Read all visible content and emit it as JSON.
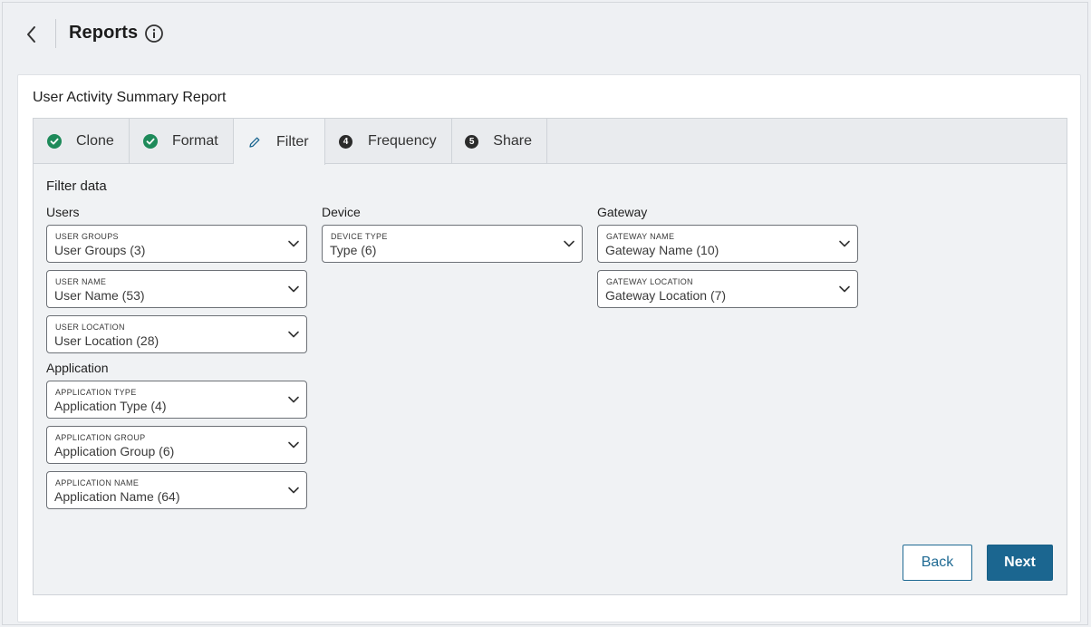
{
  "header": {
    "title": "Reports"
  },
  "report": {
    "title": "User Activity Summary Report"
  },
  "tabs": [
    {
      "label": "Clone",
      "status": "complete"
    },
    {
      "label": "Format",
      "status": "complete"
    },
    {
      "label": "Filter",
      "status": "active"
    },
    {
      "label": "Frequency",
      "status": "pending",
      "number": "4"
    },
    {
      "label": "Share",
      "status": "pending",
      "number": "5"
    }
  ],
  "filter": {
    "title": "Filter data",
    "users": {
      "label": "Users",
      "fields": [
        {
          "label": "USER GROUPS",
          "value": "User Groups (3)"
        },
        {
          "label": "USER NAME",
          "value": "User Name (53)"
        },
        {
          "label": "USER LOCATION",
          "value": "User Location (28)"
        }
      ]
    },
    "application": {
      "label": "Application",
      "fields": [
        {
          "label": "APPLICATION TYPE",
          "value": "Application Type (4)"
        },
        {
          "label": "APPLICATION GROUP",
          "value": "Application Group (6)"
        },
        {
          "label": "APPLICATION NAME",
          "value": "Application Name (64)"
        }
      ]
    },
    "device": {
      "label": "Device",
      "fields": [
        {
          "label": "DEVICE TYPE",
          "value": "Type (6)"
        }
      ]
    },
    "gateway": {
      "label": "Gateway",
      "fields": [
        {
          "label": "GATEWAY NAME",
          "value": "Gateway Name (10)"
        },
        {
          "label": "GATEWAY LOCATION",
          "value": "Gateway Location (7)"
        }
      ]
    }
  },
  "buttons": {
    "back": "Back",
    "next": "Next"
  },
  "colors": {
    "accent": "#1b6690",
    "success": "#1e8a5a",
    "tab_bg": "#e9ebee"
  }
}
